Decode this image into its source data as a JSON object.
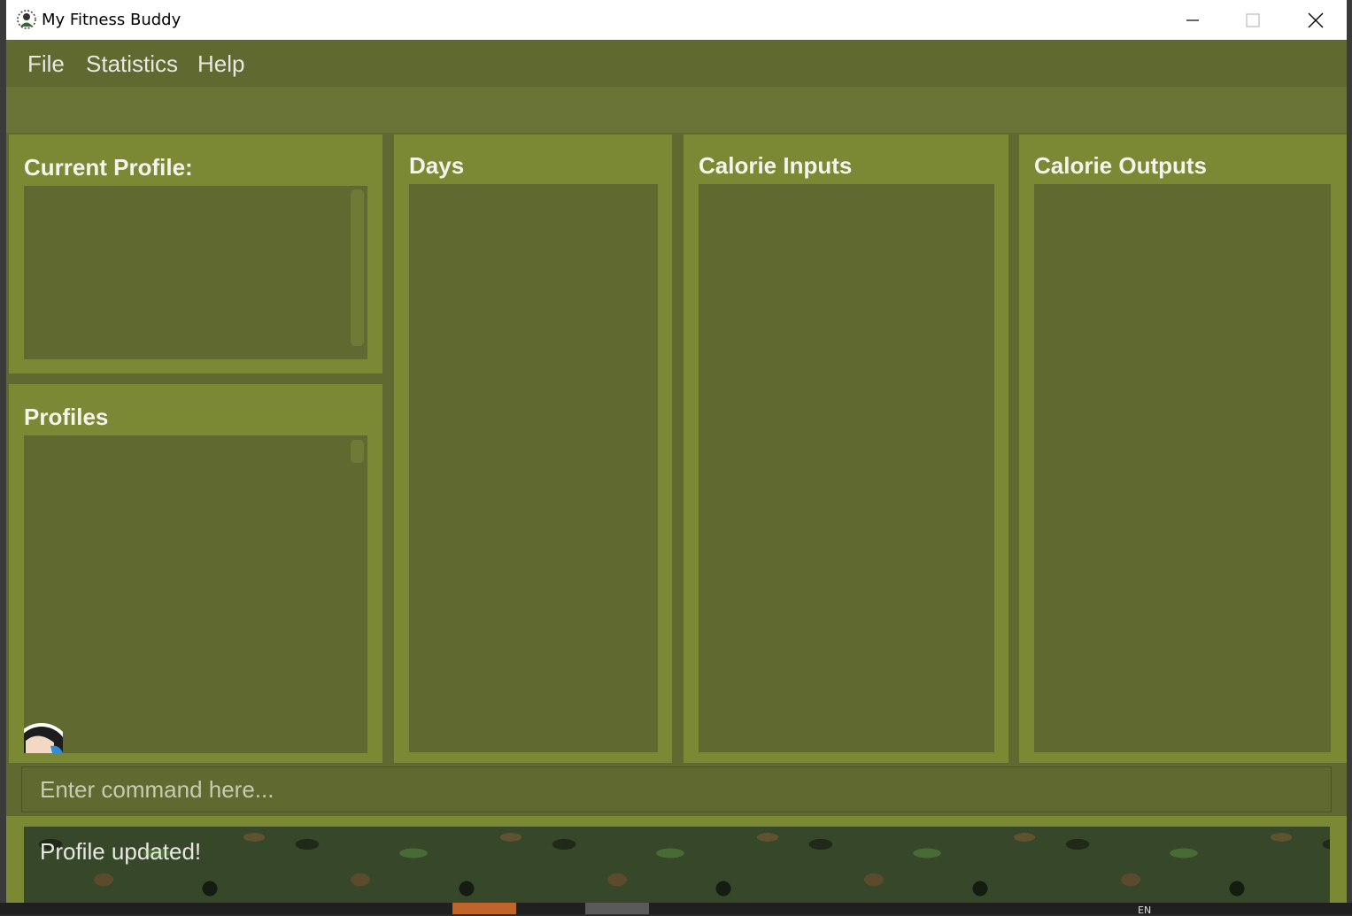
{
  "window": {
    "title": "My Fitness Buddy"
  },
  "menu": {
    "items": [
      "File",
      "Statistics",
      "Help"
    ]
  },
  "panels": {
    "current_profile": {
      "title": "Current Profile:"
    },
    "profiles": {
      "title": "Profiles"
    },
    "days": {
      "title": "Days"
    },
    "calorie_inputs": {
      "title": "Calorie Inputs"
    },
    "calorie_outputs": {
      "title": "Calorie Outputs"
    }
  },
  "command": {
    "placeholder": "Enter command here...",
    "value": ""
  },
  "result": {
    "text": "Profile updated!"
  },
  "taskbar": {
    "language": "EN"
  },
  "colors": {
    "panel_bg": "#7c8934",
    "list_bg": "#5f6930",
    "title_bar": "#ffffff"
  }
}
